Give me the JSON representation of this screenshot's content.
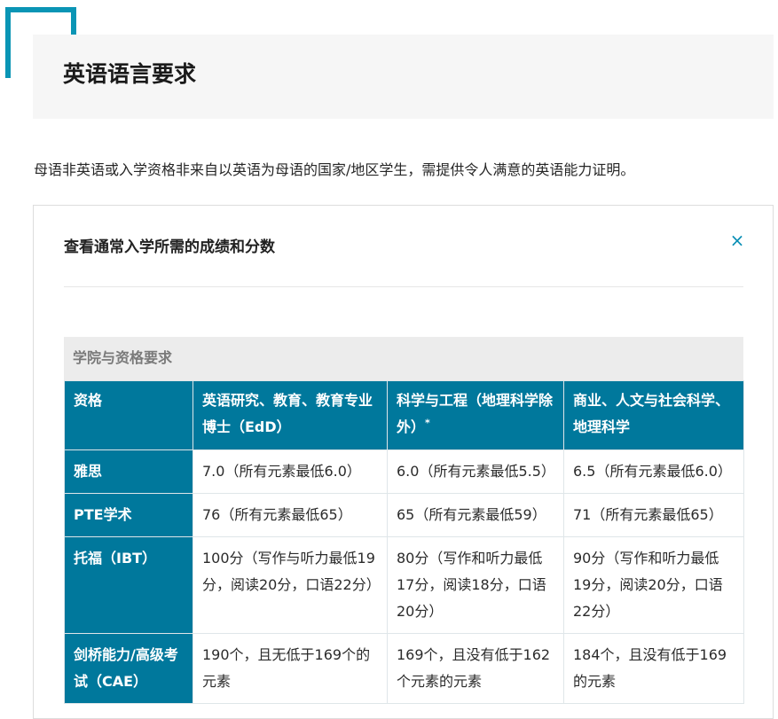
{
  "header": {
    "title": "英语语言要求"
  },
  "intro": "母语非英语或入学资格非来自以英语为母语的国家/地区学生，需提供令人满意的英语能力证明。",
  "panel": {
    "heading": "查看通常入学所需的成绩和分数",
    "close_icon": "×"
  },
  "table": {
    "caption": "学院与资格要求",
    "columns": {
      "qualification": "资格",
      "col_a": "英语研究、教育、教育专业博士（EdD）",
      "col_b": "科学与工程（地理科学除外）",
      "col_b_mark": "*",
      "col_c": "商业、人文与社会科学、地理科学"
    },
    "rows": [
      {
        "label": "雅思",
        "a": "7.0（所有元素最低6.0）",
        "b": "6.0（所有元素最低5.5）",
        "c": "6.5（所有元素最低6.0）"
      },
      {
        "label": "PTE学术",
        "a": "76（所有元素最低65）",
        "b": "65（所有元素最低59）",
        "c": "71（所有元素最低65）"
      },
      {
        "label": "托福（IBT）",
        "a": "100分（写作与听力最低19分，阅读20分，口语22分）",
        "b": "80分（写作和听力最低17分，阅读18分，口语20分）",
        "c": "90分（写作和听力最低19分，阅读20分，口语22分）"
      },
      {
        "label": "剑桥能力/高级考试（CAE）",
        "a": "190个，且无低于169个的元素",
        "b": "169个，且没有低于162个元素的元素",
        "c": "184个，且没有低于169的元素"
      }
    ]
  },
  "colors": {
    "accent": "#0a95b5",
    "table_header": "#00789c",
    "title_bg": "#f6f6f6"
  }
}
